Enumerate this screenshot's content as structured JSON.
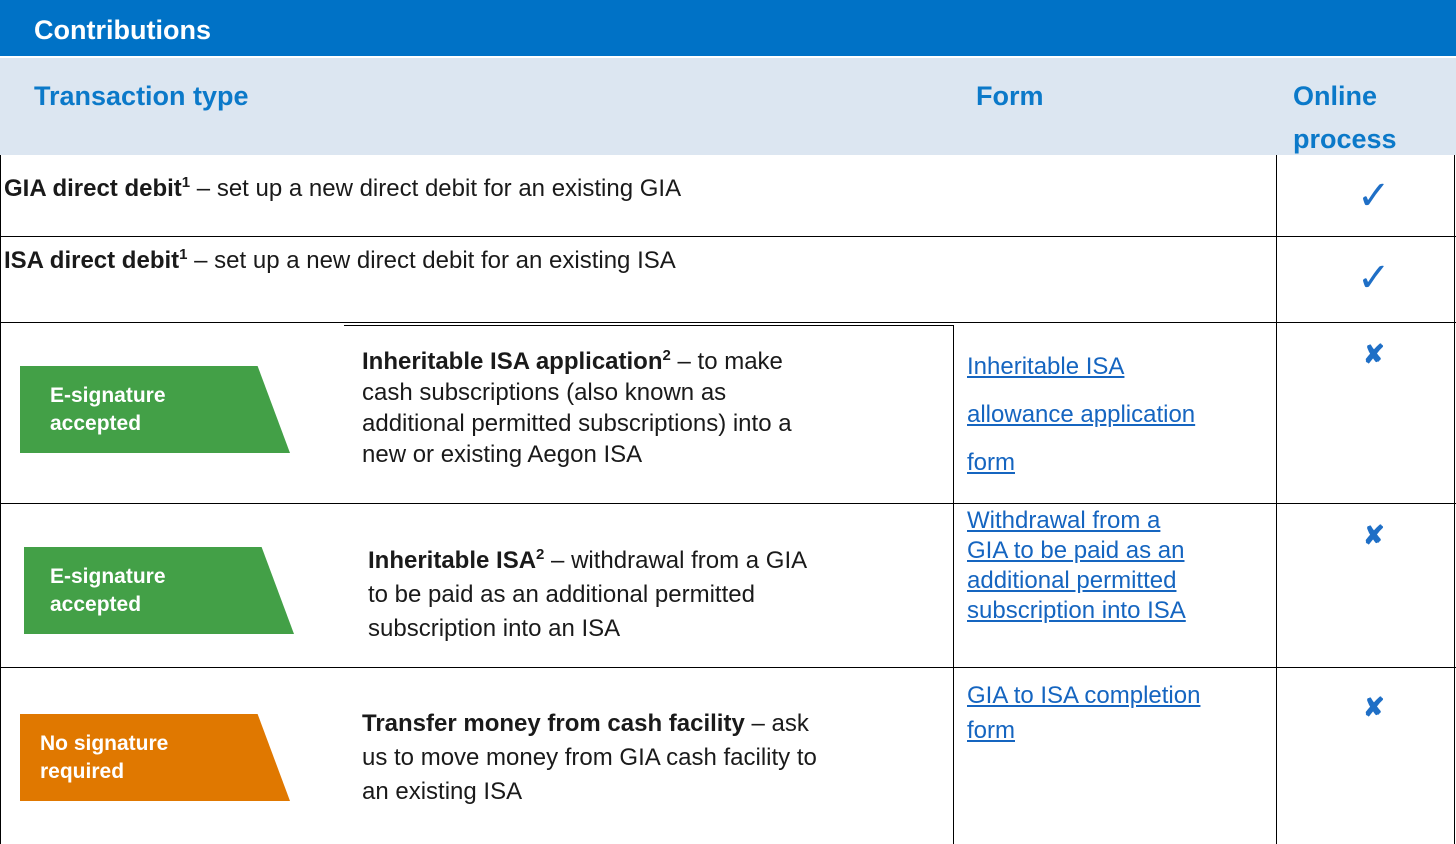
{
  "title": "Contributions",
  "headers": {
    "transaction_type": "Transaction type",
    "form": "Form",
    "online_process_line1": "Online",
    "online_process_line2": "process"
  },
  "rows": [
    {
      "bold": "GIA direct debit",
      "sup": "1",
      "text": " – set up a new direct debit for an existing GIA",
      "online": "tick"
    },
    {
      "bold": "ISA direct debit",
      "sup": "1",
      "text": " – set up a new direct debit for an existing ISA",
      "online": "tick"
    },
    {
      "badge_line1": "E-signature",
      "badge_line2": "accepted",
      "bold": "Inheritable ISA application",
      "sup": "2",
      "text_lines": [
        " – to make",
        "cash subscriptions (also known as",
        "additional permitted subscriptions) into a",
        "new or existing Aegon ISA"
      ],
      "form_lines": [
        "Inheritable ISA",
        "allowance application",
        "form"
      ],
      "online": "cross"
    },
    {
      "badge_line1": "E-signature",
      "badge_line2": "accepted",
      "bold": "Inheritable ISA",
      "sup": "2",
      "text_lines": [
        " – withdrawal from a GIA",
        "to be paid as an additional permitted",
        "subscription into an ISA"
      ],
      "form_lines": [
        "Withdrawal from a",
        "GIA to be paid as an",
        "additional permitted",
        "subscription into ISA"
      ],
      "online": "cross"
    },
    {
      "badge_line1": "No signature",
      "badge_line2": "required",
      "bold": "Transfer money from cash facility",
      "text_lines": [
        " – ask",
        "us to move money from GIA cash facility to",
        "an existing ISA"
      ],
      "form_lines": [
        "GIA to ISA completion",
        "form"
      ],
      "online": "cross"
    }
  ],
  "icons": {
    "tick": "✓",
    "cross": "✘"
  },
  "colors": {
    "title_bar": "#0072c6",
    "header_bg": "#dce6f1",
    "header_text": "#0b79c9",
    "badge_green": "#43a047",
    "badge_orange": "#e07800",
    "link": "#1565c0"
  }
}
